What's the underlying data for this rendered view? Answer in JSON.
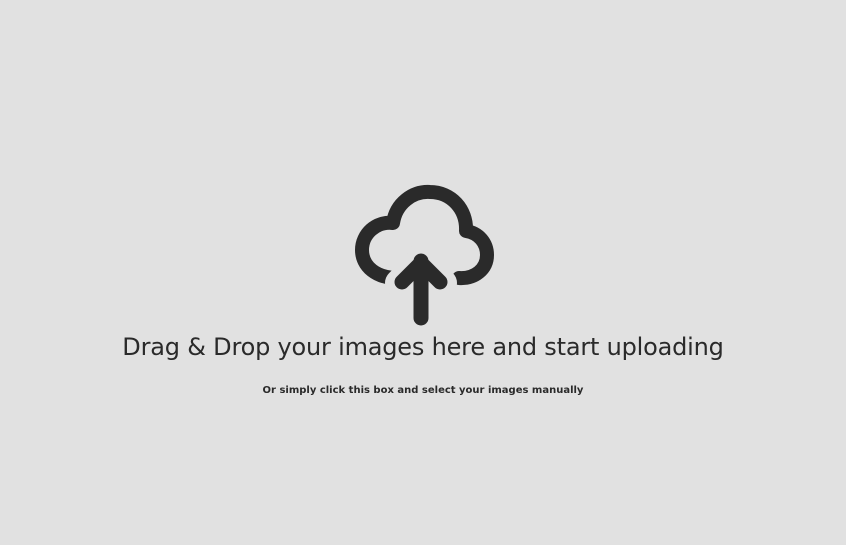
{
  "dropzone": {
    "icon": "cloud-upload-icon",
    "headline": "Drag & Drop your images here and start uploading",
    "subline": "Or simply click this box and select your images manually",
    "background_color": "#e1e1e1",
    "icon_color": "#2a2a2a"
  }
}
